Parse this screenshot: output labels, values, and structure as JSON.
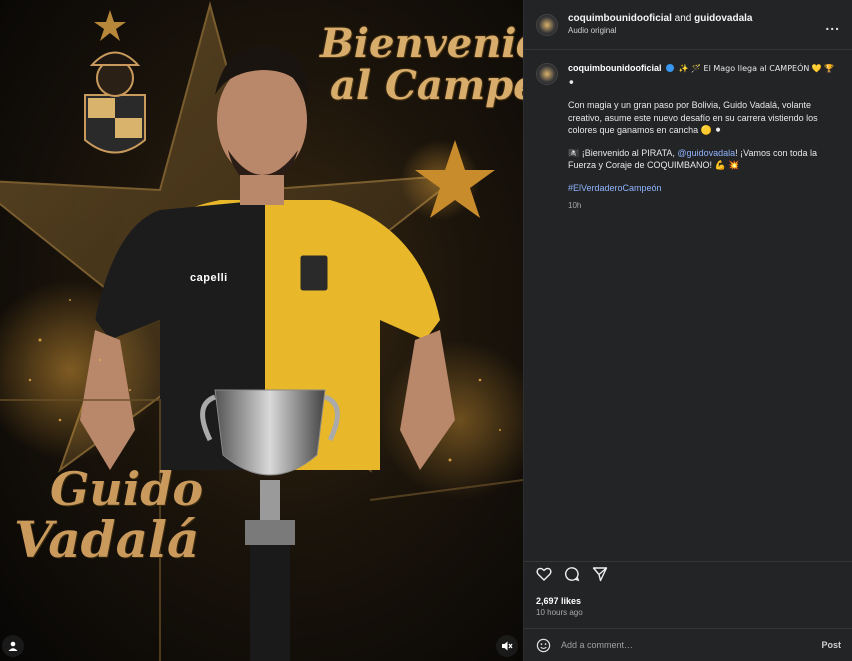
{
  "media": {
    "title_line1": "Bienvenido",
    "title_line2": "al Campeón",
    "name_line1": "Guido",
    "name_line2": "Vadalá",
    "shirt_brand": "capelli"
  },
  "header": {
    "account": "coquimbounidooficial",
    "joiner": "and",
    "collaborator": "guidovadala",
    "audio": "Audio original",
    "more": "..."
  },
  "caption": {
    "username": "coquimbounidooficial",
    "line1": "✨ 🪄 El Mago llega al CAMPEÓN 💛 🏆 ⚫",
    "paragraph1": "Con magia y un gran paso por Bolivia, Guido Vadalá, volante creativo, asume este nuevo desafío en su carrera vistiendo los colores que ganamos en cancha 🟡 ⚫",
    "p2_before": "🏴‍☠️ ¡Bienvenido al PIRATA, ",
    "p2_mention": "@guidovadala",
    "p2_after": "! ¡Vamos con toda la Fuerza y Coraje de COQUIMBANO! 💪 💥",
    "hashtag": "#ElVerdaderoCampeón",
    "time": "10h"
  },
  "footer": {
    "likes": "2,697 likes",
    "ago": "10 hours ago",
    "comment_placeholder": "Add a comment…",
    "post": "Post"
  },
  "icons": {
    "like": "heart-icon",
    "comment": "comment-icon",
    "share": "share-icon",
    "emoji": "emoji-icon",
    "user_tag": "user-icon",
    "mute": "mute-icon"
  },
  "colors": {
    "sidebar_bg": "#232426",
    "link": "#8fb4ff",
    "verified": "#3897f0",
    "gold": "#d8ad6c"
  }
}
